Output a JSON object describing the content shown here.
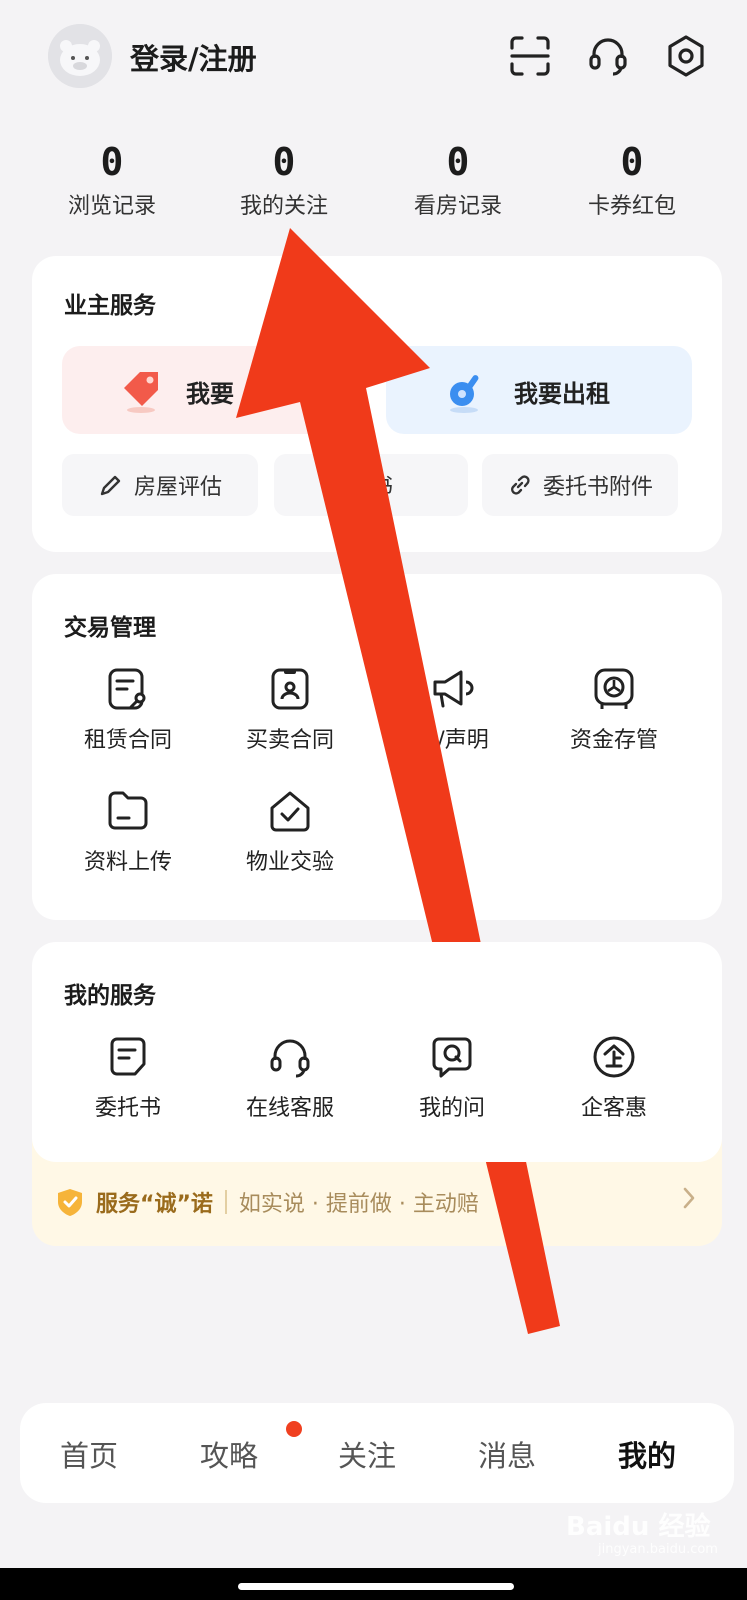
{
  "header": {
    "login_label": "登录/注册",
    "icons": [
      "scan-icon",
      "headset-icon",
      "settings-icon"
    ]
  },
  "stats": [
    {
      "value": "0",
      "label": "浏览记录"
    },
    {
      "value": "0",
      "label": "我的关注"
    },
    {
      "value": "0",
      "label": "看房记录"
    },
    {
      "value": "0",
      "label": "卡券红包"
    }
  ],
  "owner_services": {
    "title": "业主服务",
    "sell_label": "我要",
    "rent_label": "我要出租",
    "small_buttons": [
      {
        "label": "房屋评估",
        "icon": "pen-icon"
      },
      {
        "label": "托书",
        "icon": ""
      },
      {
        "label": "委托书附件",
        "icon": "link-icon"
      }
    ]
  },
  "transaction": {
    "title": "交易管理",
    "items": [
      {
        "label": "租赁合同",
        "icon": "lease-contract-icon"
      },
      {
        "label": "买卖合同",
        "icon": "sale-contract-icon"
      },
      {
        "label": "议/声明",
        "icon": "megaphone-icon"
      },
      {
        "label": "资金存管",
        "icon": "safe-icon"
      },
      {
        "label": "资料上传",
        "icon": "folder-icon"
      },
      {
        "label": "物业交验",
        "icon": "house-check-icon"
      }
    ]
  },
  "my_services": {
    "title": "我的服务",
    "items": [
      {
        "label": "委托书",
        "icon": "document-icon"
      },
      {
        "label": "在线客服",
        "icon": "headset-icon"
      },
      {
        "label": "我的问",
        "icon": "question-icon"
      },
      {
        "label": "企客惠",
        "icon": "enterprise-icon"
      }
    ],
    "promise_title": "服务“诚”诺",
    "promise_desc": "如实说 · 提前做 · 主动赔"
  },
  "tabbar": {
    "tabs": [
      "首页",
      "攻略",
      "关注",
      "消息",
      "我的"
    ],
    "active": "我的"
  },
  "watermark": {
    "text": "Baidu 经验",
    "sub": "jingyan.baidu.com"
  },
  "colors": {
    "accent_red": "#f03a1a",
    "promise_bg": "#fff8e6",
    "card_bg": "#ffffff"
  }
}
